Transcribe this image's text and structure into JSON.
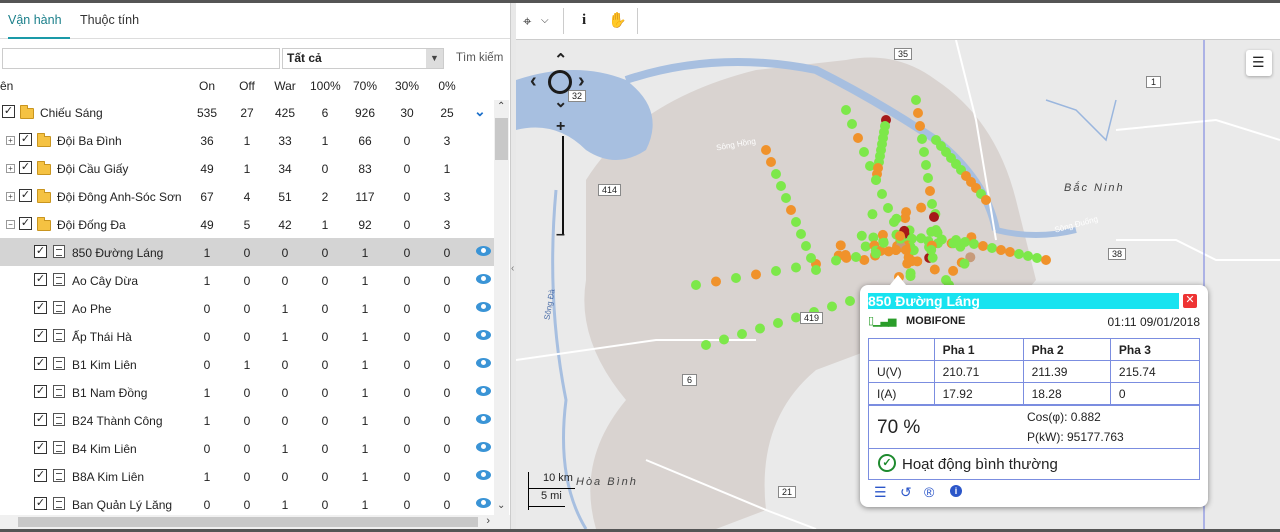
{
  "tabs": [
    "Vận hành",
    "Thuộc tính"
  ],
  "search": {
    "placeholder": "",
    "filter": "Tất cả",
    "button": "Tìm kiếm"
  },
  "columns": [
    "ên",
    "On",
    "Off",
    "War",
    "100%",
    "70%",
    "30%",
    "0%"
  ],
  "rows": [
    {
      "name": "Chiếu Sáng",
      "vals": [
        "535",
        "27",
        "425",
        "6",
        "926",
        "30",
        "25"
      ]
    },
    {
      "name": "Đội Ba Đình",
      "vals": [
        "36",
        "1",
        "33",
        "1",
        "66",
        "0",
        "3"
      ]
    },
    {
      "name": "Đội Cầu Giấy",
      "vals": [
        "49",
        "1",
        "34",
        "0",
        "83",
        "0",
        "1"
      ]
    },
    {
      "name": "Đội Đông Anh-Sóc Sơn",
      "vals": [
        "67",
        "4",
        "51",
        "2",
        "117",
        "0",
        "3"
      ]
    },
    {
      "name": "Đội Đống Đa",
      "vals": [
        "49",
        "5",
        "42",
        "1",
        "92",
        "0",
        "3"
      ]
    },
    {
      "name": "850 Đường Láng",
      "vals": [
        "1",
        "0",
        "0",
        "0",
        "1",
        "0",
        "0"
      ]
    },
    {
      "name": "Ao Cây Dừa",
      "vals": [
        "1",
        "0",
        "0",
        "0",
        "1",
        "0",
        "0"
      ]
    },
    {
      "name": "Ao Phe",
      "vals": [
        "0",
        "0",
        "1",
        "0",
        "1",
        "0",
        "0"
      ]
    },
    {
      "name": "Ấp Thái Hà",
      "vals": [
        "0",
        "0",
        "1",
        "0",
        "1",
        "0",
        "0"
      ]
    },
    {
      "name": "B1 Kim Liên",
      "vals": [
        "0",
        "1",
        "0",
        "0",
        "1",
        "0",
        "0"
      ]
    },
    {
      "name": "B1 Nam Đồng",
      "vals": [
        "1",
        "0",
        "0",
        "0",
        "1",
        "0",
        "0"
      ]
    },
    {
      "name": "B24 Thành Công",
      "vals": [
        "1",
        "0",
        "0",
        "0",
        "1",
        "0",
        "0"
      ]
    },
    {
      "name": "B4 Kim Liên",
      "vals": [
        "0",
        "0",
        "1",
        "0",
        "1",
        "0",
        "0"
      ]
    },
    {
      "name": "B8A Kim Liên",
      "vals": [
        "1",
        "0",
        "0",
        "0",
        "1",
        "0",
        "0"
      ]
    },
    {
      "name": "Ban Quản Lý Lăng",
      "vals": [
        "0",
        "0",
        "1",
        "0",
        "1",
        "0",
        "0"
      ]
    }
  ],
  "map_labels": {
    "r35": "35",
    "r32": "32",
    "r1": "1",
    "r414": "414",
    "r38": "38",
    "r419": "419",
    "r6": "6",
    "r21": "21",
    "bacninh": "Bắc Ninh",
    "songhong": "Sông Hồng",
    "songduong": "Sông Đuống",
    "songda": "Sông Đà",
    "hoabinh": "Hòa Bình",
    "scale_km": "10 km",
    "scale_mi": "5 mi"
  },
  "popup": {
    "title": "850 Đường Láng",
    "carrier": "MOBIFONE",
    "datetime": "01:11 09/01/2018",
    "phase_headers": [
      "Pha 1",
      "Pha 2",
      "Pha 3"
    ],
    "u_label": "U(V)",
    "u": [
      "210.71",
      "211.39",
      "215.74"
    ],
    "i_label": "I(A)",
    "i": [
      "17.92",
      "18.28",
      "0"
    ],
    "dim": "70 %",
    "cos": "Cos(φ): 0.882",
    "power": "P(kW): 95177.763",
    "status": "Hoạt động bình thường"
  }
}
